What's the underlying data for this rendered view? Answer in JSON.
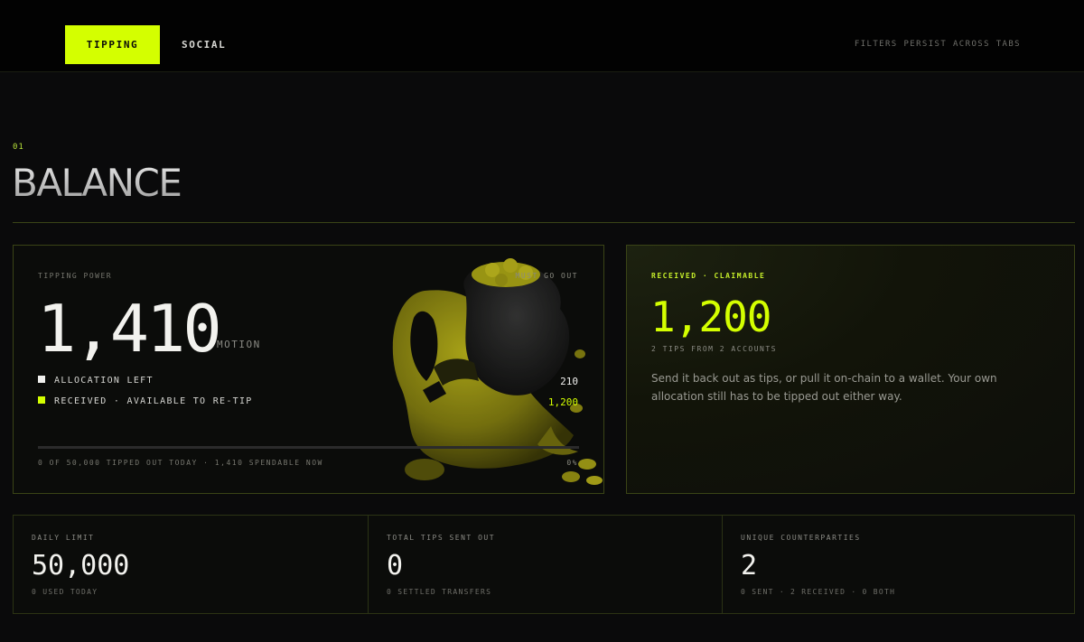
{
  "nav": {
    "tabs": [
      {
        "label": "TIPPING",
        "active": true
      },
      {
        "label": "SOCIAL",
        "active": false
      }
    ],
    "note": "FILTERS PERSIST ACROSS TABS"
  },
  "section": {
    "number": "01",
    "title": "BALANCE"
  },
  "tipping_power": {
    "label": "TIPPING POWER",
    "badge": "MUST GO OUT",
    "value": "1,410",
    "unit": "MOTION",
    "legend": [
      {
        "label": "ALLOCATION LEFT",
        "value": "210",
        "color": "#f0f0ee"
      },
      {
        "label": "RECEIVED · AVAILABLE TO RE-TIP",
        "value": "1,200",
        "color": "#d4ff00"
      }
    ],
    "progress": 0,
    "footer": "0 OF 50,000 TIPPED OUT TODAY · 1,410 SPENDABLE NOW",
    "percent": "0%"
  },
  "received": {
    "label": "RECEIVED · CLAIMABLE",
    "value": "1,200",
    "sub": "2 TIPS FROM 2 ACCOUNTS",
    "description": "Send it back out as tips, or pull it on-chain to a wallet. Your own allocation still has to be tipped out either way."
  },
  "stats": [
    {
      "label": "DAILY LIMIT",
      "value": "50,000",
      "sub": "0 USED TODAY"
    },
    {
      "label": "TOTAL TIPS SENT OUT",
      "value": "0",
      "sub": "0 SETTLED TRANSFERS"
    },
    {
      "label": "UNIQUE COUNTERPARTIES",
      "value": "2",
      "sub": "0 SENT · 2 RECEIVED · 0 BOTH"
    }
  ],
  "colors": {
    "accent": "#d4ff00",
    "background": "#0a0a0b",
    "border": "#3a4416"
  }
}
